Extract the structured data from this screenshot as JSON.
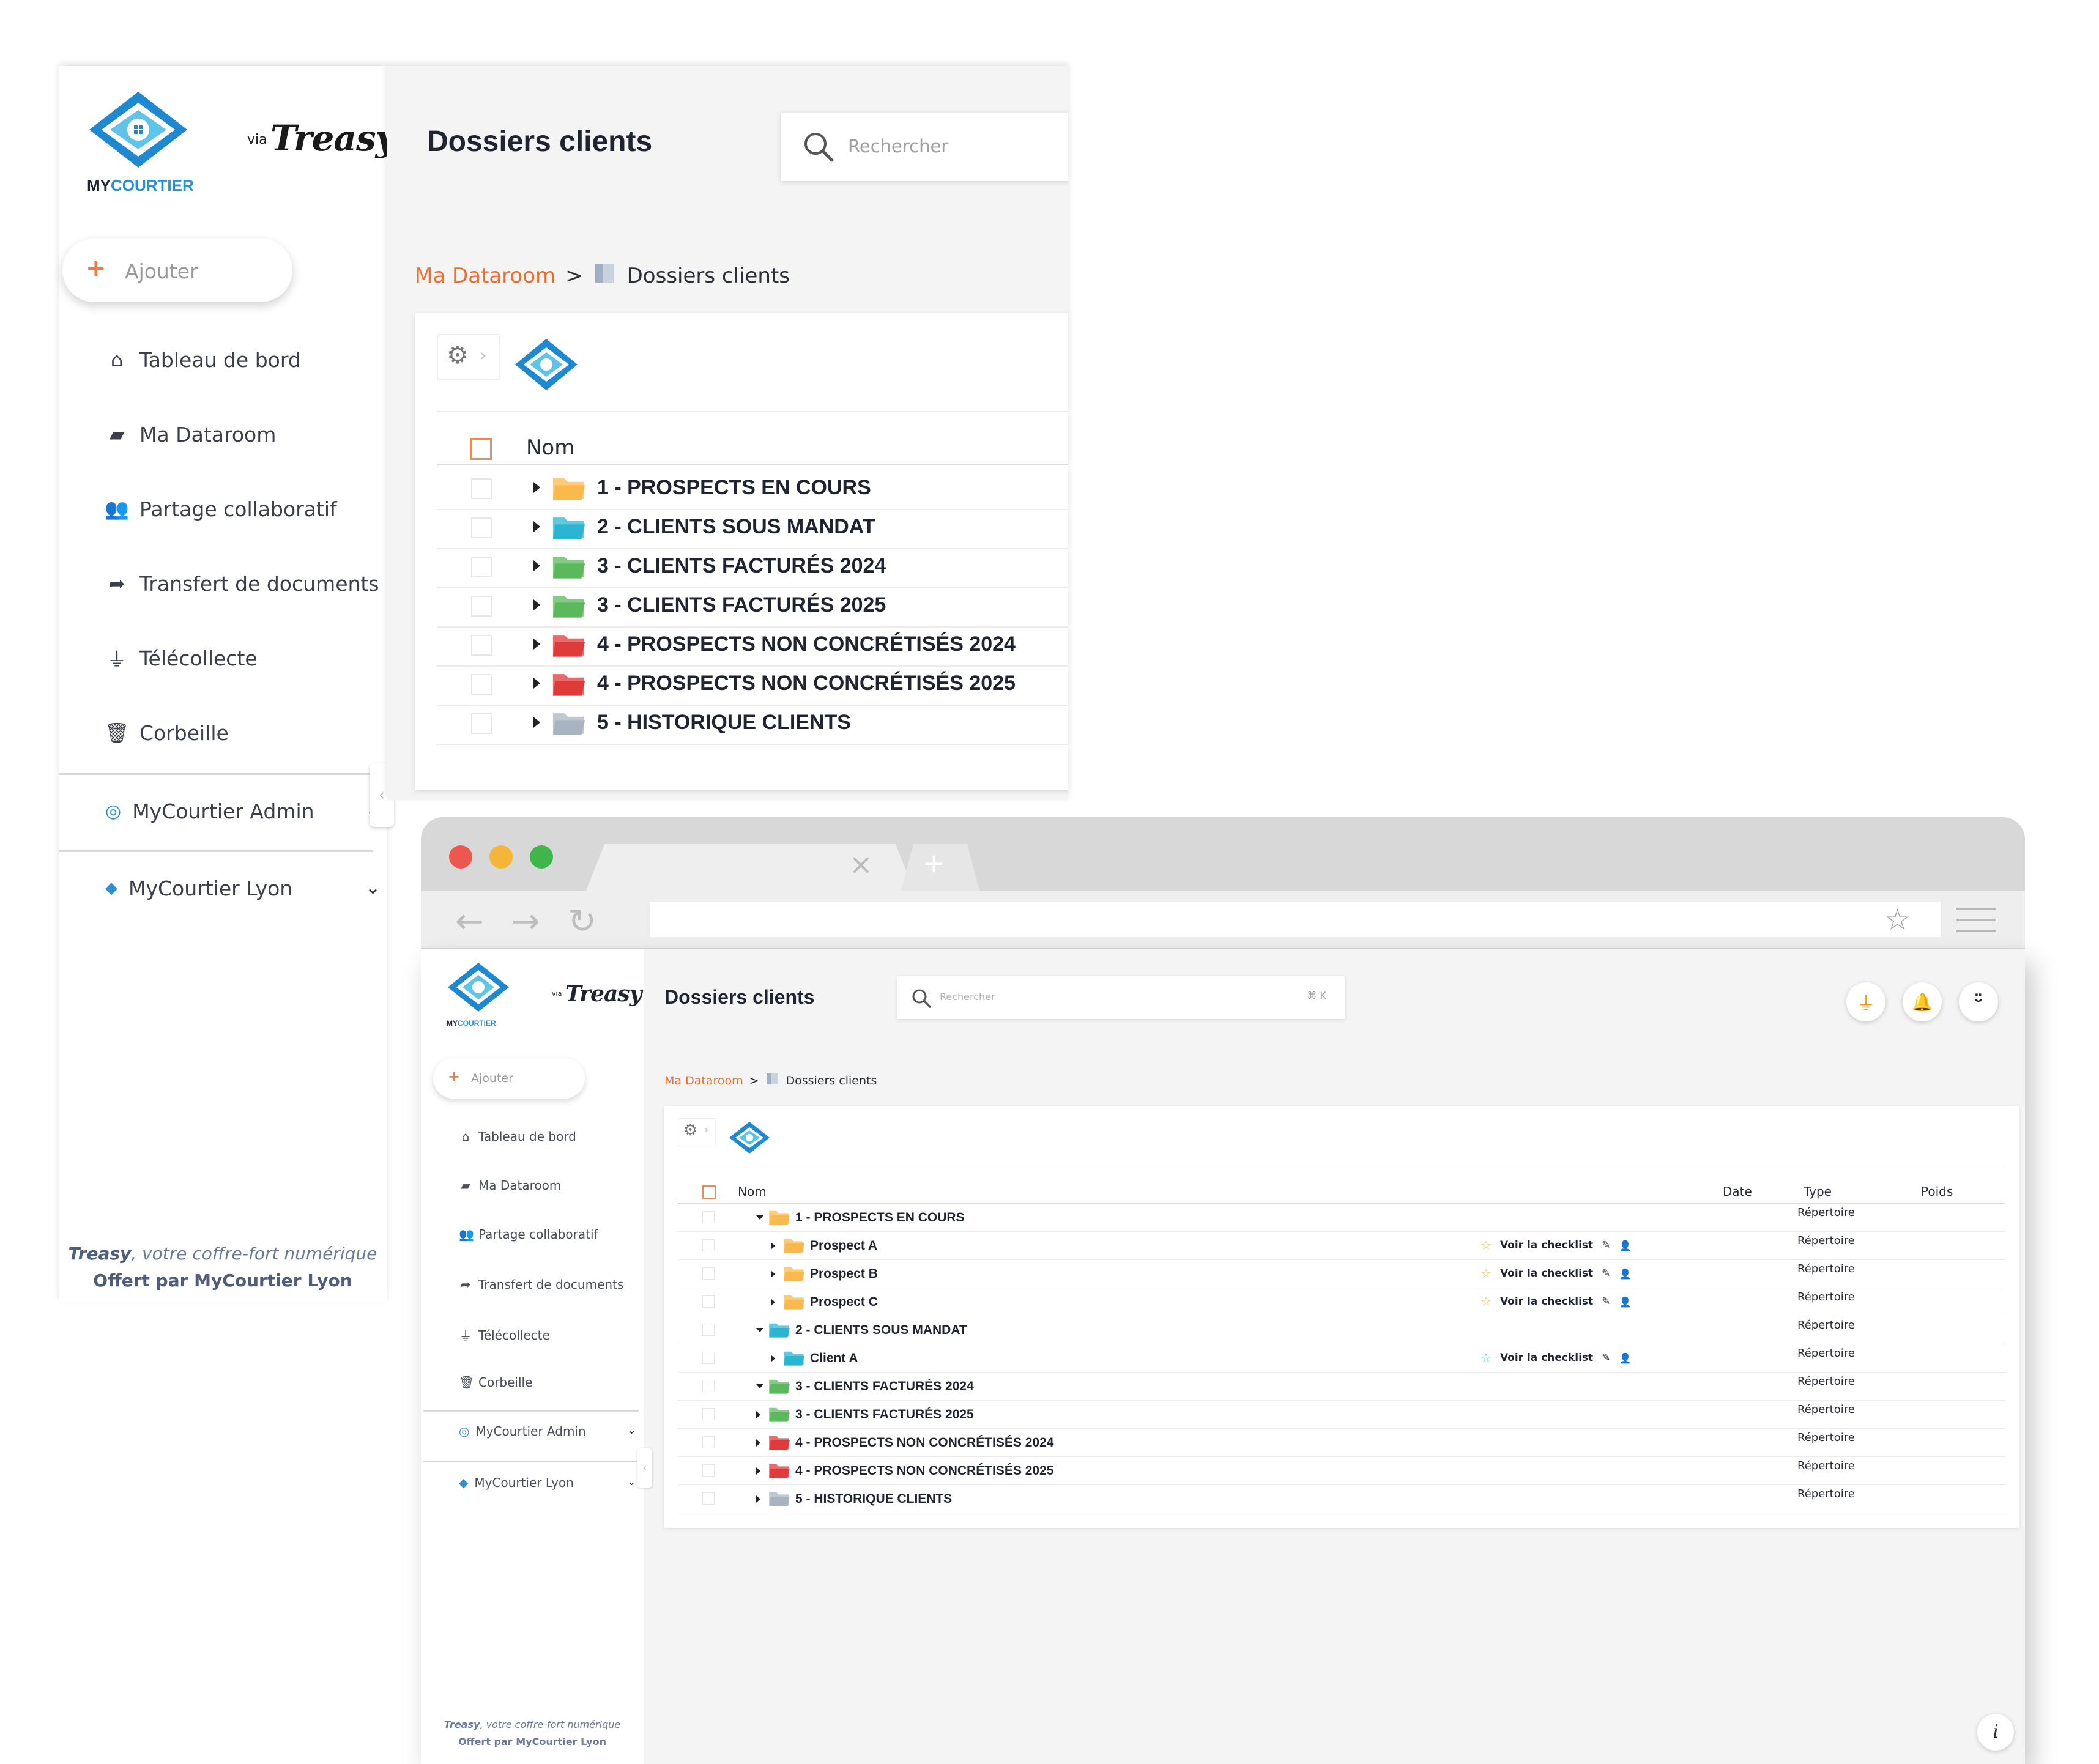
{
  "app": {
    "brand_prefix": "MY",
    "brand_suffix": "COURTIER",
    "via": "via",
    "partner": "Treasy",
    "page_title": "Dossiers clients",
    "search_placeholder": "Rechercher",
    "search_shortcut": "⌘ K"
  },
  "sidebar": {
    "add_label": "Ajouter",
    "items": [
      {
        "label": "Tableau de bord",
        "icon": "home-icon"
      },
      {
        "label": "Ma Dataroom",
        "icon": "folder-icon"
      },
      {
        "label": "Partage collaboratif",
        "icon": "users-icon"
      },
      {
        "label": "Transfert de documents",
        "icon": "share-icon"
      },
      {
        "label": "Télécollecte",
        "icon": "plug-icon"
      },
      {
        "label": "Corbeille",
        "icon": "trash-icon"
      }
    ],
    "orgs": [
      {
        "label": "MyCourtier Admin",
        "icon": "target-icon"
      },
      {
        "label": "MyCourtier Lyon",
        "icon": "diamond-icon"
      }
    ],
    "footer_brand": "Treasy",
    "footer_tagline": ", votre coffre-fort numérique",
    "footer_offer": "Offert par MyCourtier Lyon"
  },
  "breadcrumb": {
    "home": "Ma Dataroom",
    "sep": ">",
    "current": "Dossiers clients"
  },
  "table": {
    "columns": {
      "name": "Nom",
      "date": "Date",
      "type": "Type",
      "size": "Poids"
    },
    "back_rows": [
      {
        "label": "1 - PROSPECTS EN COURS",
        "color": "#f9b94c"
      },
      {
        "label": "2 - CLIENTS SOUS MANDAT",
        "color": "#2bb5d4"
      },
      {
        "label": "3 - CLIENTS FACTURÉS 2024",
        "color": "#5cb85c"
      },
      {
        "label": "3 - CLIENTS FACTURÉS 2025",
        "color": "#5cb85c"
      },
      {
        "label": "4 - PROSPECTS NON CONCRÉTISÉS 2024",
        "color": "#e03a3a"
      },
      {
        "label": "4 - PROSPECTS NON CONCRÉTISÉS 2025",
        "color": "#e03a3a"
      },
      {
        "label": "5 - HISTORIQUE CLIENTS",
        "color": "#a9b4c2"
      }
    ],
    "front_rows": [
      {
        "label": "1 - PROSPECTS EN COURS",
        "color": "#f9b94c",
        "level": 0,
        "expanded": true,
        "type": "Répertoire",
        "checklist": false
      },
      {
        "label": "Prospect A",
        "color": "#f9b94c",
        "level": 1,
        "expanded": false,
        "type": "Répertoire",
        "checklist": true
      },
      {
        "label": "Prospect B",
        "color": "#f9b94c",
        "level": 1,
        "expanded": false,
        "type": "Répertoire",
        "checklist": true
      },
      {
        "label": "Prospect C",
        "color": "#f9b94c",
        "level": 1,
        "expanded": false,
        "type": "Répertoire",
        "checklist": true
      },
      {
        "label": "2 - CLIENTS SOUS MANDAT",
        "color": "#2bb5d4",
        "level": 0,
        "expanded": true,
        "type": "Répertoire",
        "checklist": false
      },
      {
        "label": "Client A",
        "color": "#2bb5d4",
        "level": 1,
        "expanded": false,
        "type": "Répertoire",
        "checklist": true
      },
      {
        "label": "3 - CLIENTS FACTURÉS 2024",
        "color": "#5cb85c",
        "level": 0,
        "expanded": true,
        "type": "Répertoire",
        "checklist": false
      },
      {
        "label": "3 - CLIENTS FACTURÉS 2025",
        "color": "#5cb85c",
        "level": 0,
        "expanded": false,
        "type": "Répertoire",
        "checklist": false
      },
      {
        "label": "4 - PROSPECTS NON CONCRÉTISÉS 2024",
        "color": "#e03a3a",
        "level": 0,
        "expanded": false,
        "type": "Répertoire",
        "checklist": false
      },
      {
        "label": "4 - PROSPECTS NON CONCRÉTISÉS 2025",
        "color": "#e03a3a",
        "level": 0,
        "expanded": false,
        "type": "Répertoire",
        "checklist": false
      },
      {
        "label": "5 - HISTORIQUE CLIENTS",
        "color": "#a9b4c2",
        "level": 0,
        "expanded": false,
        "type": "Répertoire",
        "checklist": false
      }
    ],
    "checklist_label": "Voir la checklist"
  },
  "colors": {
    "accent_orange": "#ef6d2e",
    "brand_blue": "#2b8fd6",
    "mac_red": "#ed5750",
    "mac_yellow": "#f5b53b",
    "mac_green": "#3fb64a"
  }
}
